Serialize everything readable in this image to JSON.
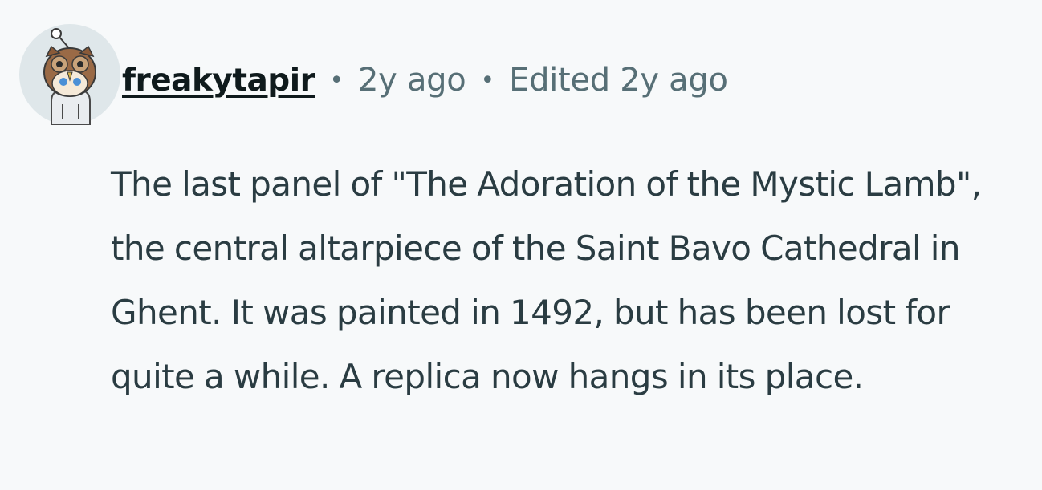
{
  "comment": {
    "author": "freakytapir",
    "separator": "•",
    "posted_ago": "2y ago",
    "edited": "Edited 2y ago",
    "avatar_icon": "snoo-owl-avatar-icon",
    "body": "The last panel of \"The Adoration of the Mystic Lamb\", the central altarpiece of the Saint Bavo Cathedral in Ghent. It was painted in 1492, but has been lost for quite a while. A replica now hangs in its place."
  },
  "colors": {
    "background": "#f7f9fa",
    "username": "#0f1a1c",
    "meta": "#576f76",
    "body_text": "#2a3c42"
  }
}
